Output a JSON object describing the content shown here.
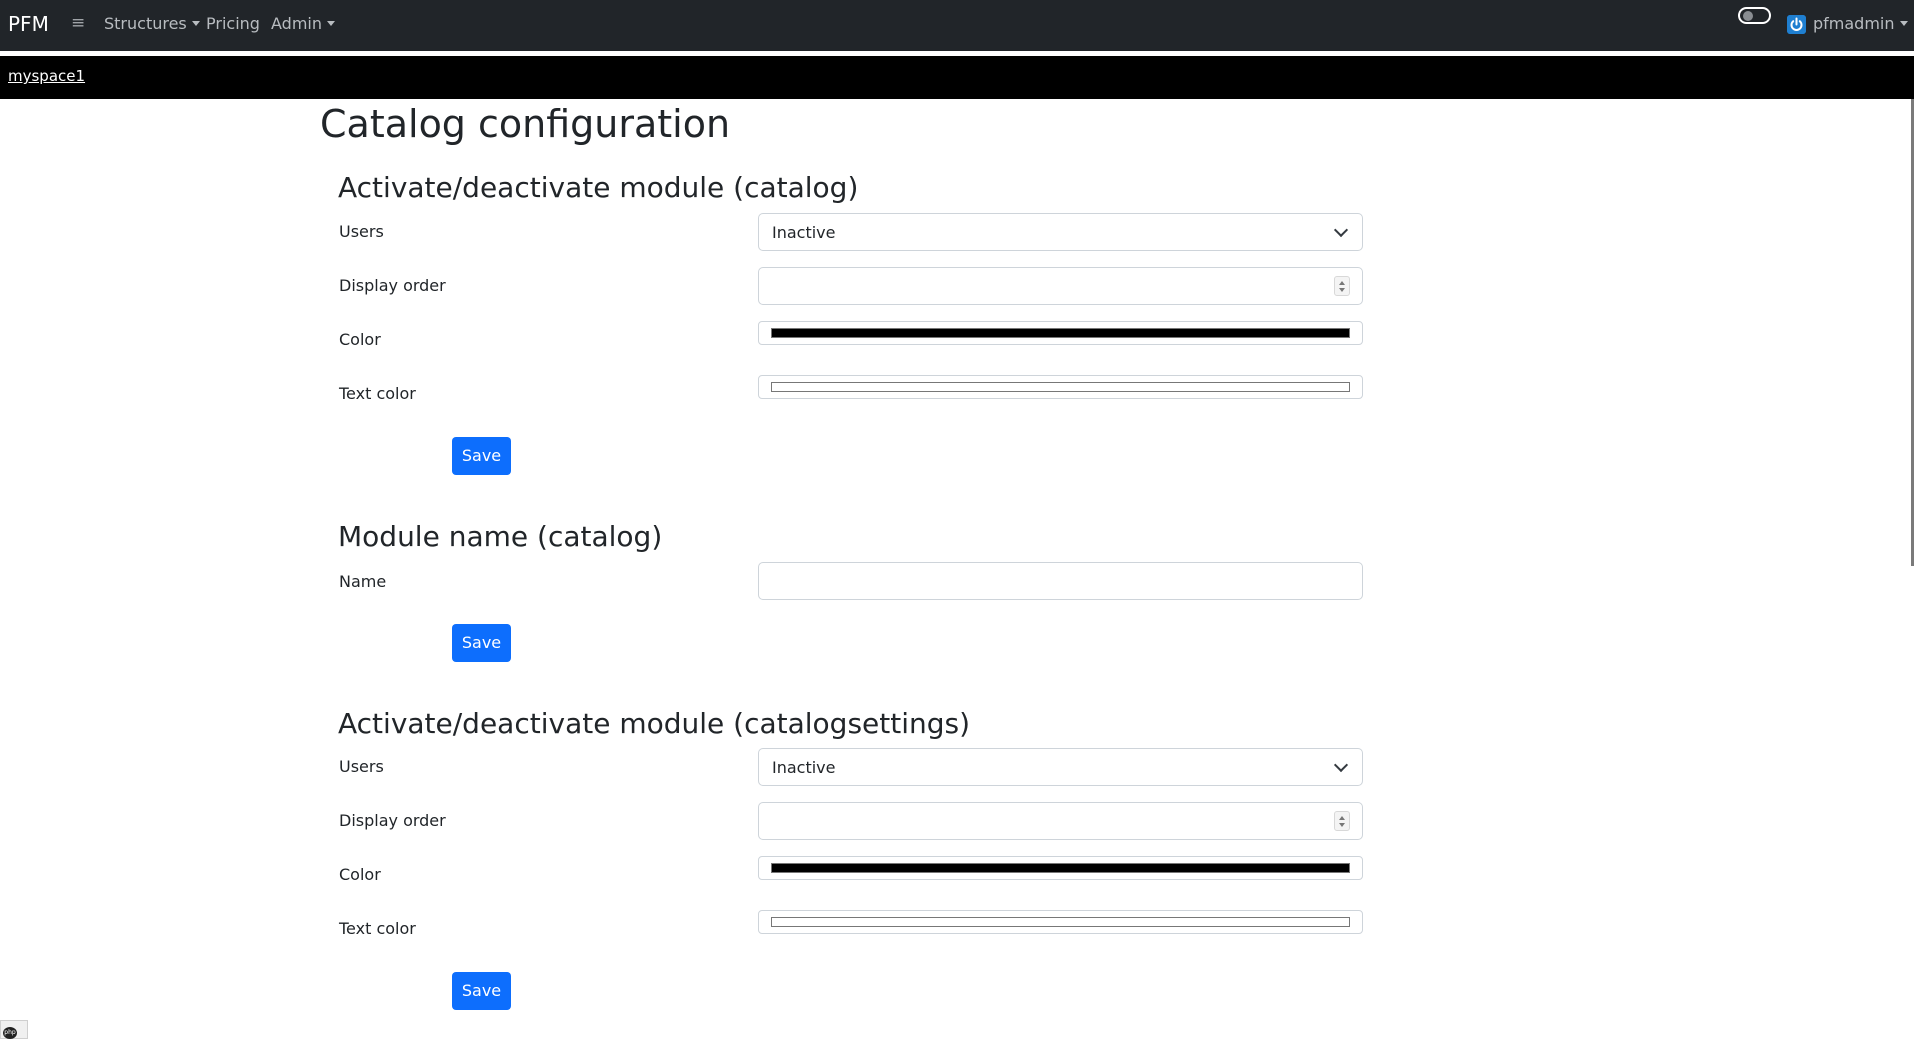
{
  "navbar": {
    "brand": "PFM",
    "menu_icon": "hamburger-icon",
    "items": [
      {
        "label": "Structures",
        "has_dropdown": true
      },
      {
        "label": "Pricing",
        "has_dropdown": false
      },
      {
        "label": "Admin",
        "has_dropdown": true
      }
    ],
    "theme_toggle": {
      "icon": "toggle-switch",
      "state": "off"
    },
    "user": {
      "name": "pfmadmin",
      "icon": "power-icon",
      "has_dropdown": true
    }
  },
  "subbar": {
    "space_link": "myspace1"
  },
  "page": {
    "title": "Catalog configuration"
  },
  "sections": [
    {
      "title": "Activate/deactivate module (catalog)",
      "users_label": "Users",
      "users_value": "Inactive",
      "display_order_label": "Display order",
      "display_order_value": "",
      "color_label": "Color",
      "color_value": "#000000",
      "text_color_label": "Text color",
      "text_color_value": "#ffffff",
      "save_label": "Save"
    },
    {
      "title": "Module name (catalog)",
      "name_label": "Name",
      "name_value": "",
      "save_label": "Save"
    },
    {
      "title": "Activate/deactivate module (catalogsettings)",
      "users_label": "Users",
      "users_value": "Inactive",
      "display_order_label": "Display order",
      "display_order_value": "",
      "color_label": "Color",
      "color_value": "#000000",
      "text_color_label": "Text color",
      "text_color_value": "#ffffff",
      "save_label": "Save"
    }
  ],
  "colors": {
    "navbar_bg": "#212529",
    "subbar_bg": "#000000",
    "primary_button": "#0d6efd",
    "user_icon": "#1f7fd0"
  },
  "footer": {
    "php_badge_icon": "php-icon",
    "php_badge_text": "php"
  }
}
